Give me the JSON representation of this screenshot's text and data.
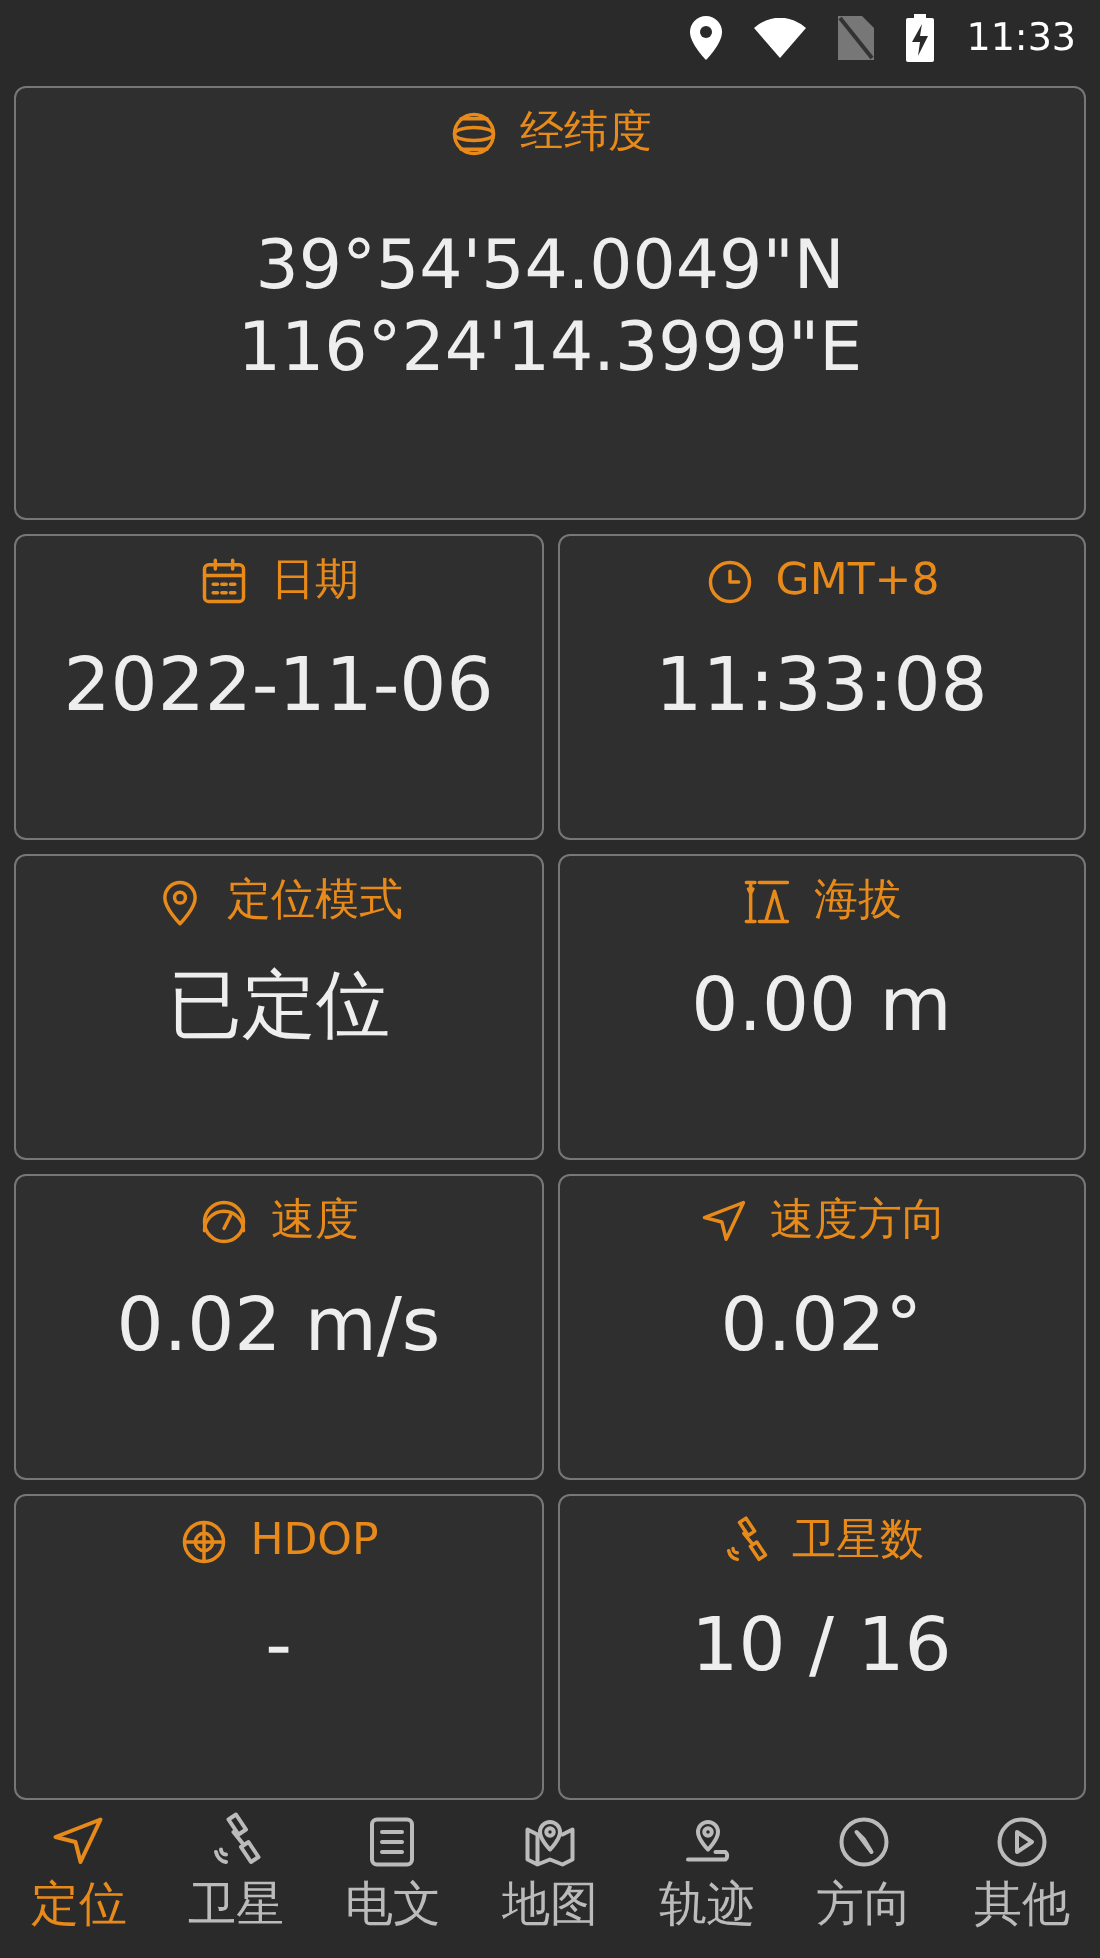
{
  "status_bar": {
    "time": "11:33"
  },
  "coordinates": {
    "label": "经纬度",
    "latitude": "39°54'54.0049\"N",
    "longitude": "116°24'14.3999\"E"
  },
  "cards": [
    {
      "label": "日期",
      "value": "2022-11-06"
    },
    {
      "label": "GMT+8",
      "value": "11:33:08"
    },
    {
      "label": "定位模式",
      "value": "已定位"
    },
    {
      "label": "海拔",
      "value": "0.00 m"
    },
    {
      "label": "速度",
      "value": "0.02 m/s"
    },
    {
      "label": "速度方向",
      "value": "0.02°"
    },
    {
      "label": "HDOP",
      "value": "-"
    },
    {
      "label": "卫星数",
      "value": "10 / 16"
    }
  ],
  "nav": [
    {
      "label": "定位",
      "selected": true
    },
    {
      "label": "卫星",
      "selected": false
    },
    {
      "label": "电文",
      "selected": false
    },
    {
      "label": "地图",
      "selected": false
    },
    {
      "label": "轨迹",
      "selected": false
    },
    {
      "label": "方向",
      "selected": false
    },
    {
      "label": "其他",
      "selected": false
    }
  ]
}
